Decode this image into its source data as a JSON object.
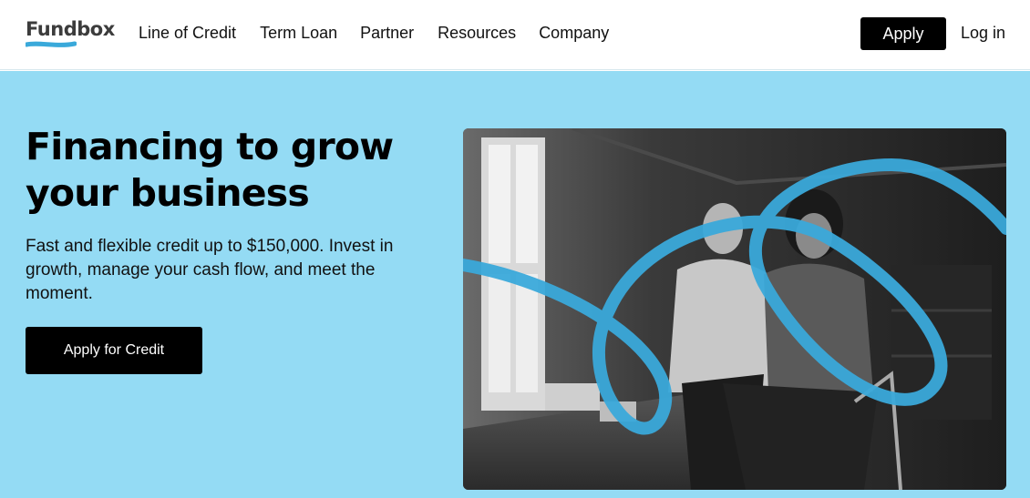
{
  "brand": {
    "logo_text": "Fundbox",
    "accent_color": "#94dbf4",
    "swoosh_color": "#3aa9da"
  },
  "nav": {
    "items": [
      {
        "label": "Line of Credit"
      },
      {
        "label": "Term Loan"
      },
      {
        "label": "Partner"
      },
      {
        "label": "Resources"
      },
      {
        "label": "Company"
      }
    ],
    "apply_label": "Apply",
    "login_label": "Log in"
  },
  "hero": {
    "title": "Financing to grow your business",
    "subtitle": "Fast and flexible credit up to $150,000. Invest in growth, manage your cash flow, and meet the moment.",
    "cta_label": "Apply for Credit"
  }
}
